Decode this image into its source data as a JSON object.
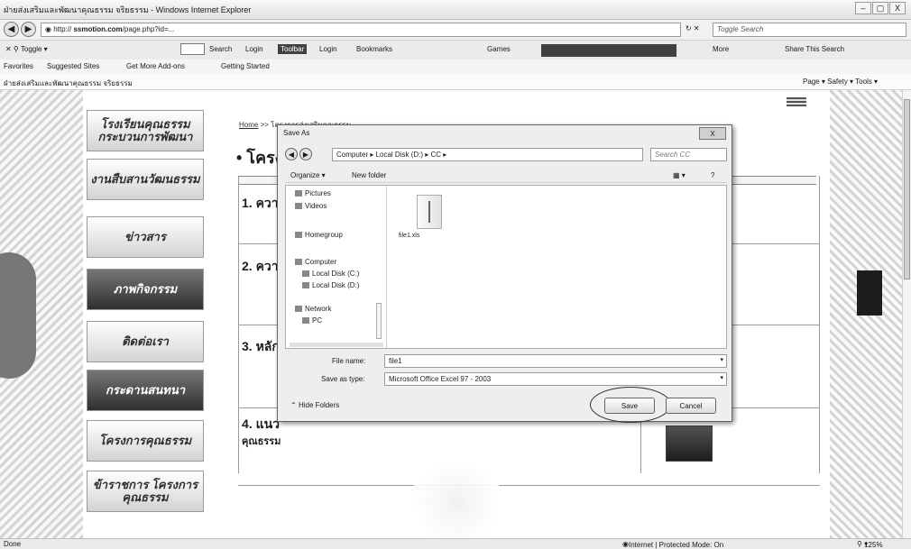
{
  "window": {
    "title": "ฝ่ายส่งเสริมและพัฒนาคุณธรรม จริยธรรม - Windows Internet Explorer",
    "buttons": {
      "minimize": "–",
      "maximize": "▢",
      "close": "X"
    }
  },
  "address_bar": {
    "url_domain": "ssmotion.com",
    "url_rest": "/page.php?id=...",
    "search_placeholder": "Toggle Search"
  },
  "toolbar": {
    "toggle": "Toggle",
    "search": "Search",
    "login": "Login",
    "toolbar_word": "Toolbar",
    "bookmarks": "Bookmarks",
    "games": "Games",
    "more": "More",
    "share": "Share This Search"
  },
  "favorites_bar": {
    "favorites": "Favorites",
    "suggested": "Suggested Sites",
    "addons": "Get More Add-ons",
    "getting_started": "Getting Started"
  },
  "tab": {
    "title": "ฝ่ายส่งเสริมและพัฒนาคุณธรรม จริยธรรม",
    "commands": "Page ▾  Safety ▾  Tools ▾"
  },
  "page": {
    "breadcrumb_home": "Home",
    "breadcrumb_rest": ">> โครงการส่งเสริมคุณธรรม",
    "title": "• โครงการ",
    "sidebar_banners": [
      "โรงเรียนคุณธรรม กระบวนการพัฒนา",
      "งานสืบสานวัฒนธรรม",
      "ข่าวสาร",
      "ภาพกิจกรรม",
      "ติดต่อเรา",
      "กระดานสนทนา",
      "โครงการคุณธรรม",
      "ข้าราชการ โครงการคุณธรรม"
    ],
    "items": [
      "1. ความ",
      "2. ความ",
      "3. หลัก",
      "4. แนว",
      "คุณธรรม"
    ]
  },
  "dialog": {
    "title": "Save As",
    "close": "X",
    "path": "Computer ▸ Local Disk (D:) ▸ CC ▸",
    "search": "Search CC",
    "organize": "Organize ▾",
    "new_folder": "New folder",
    "nav_items": [
      "Pictures",
      "Videos",
      "Homegroup",
      "Computer",
      "Local Disk (C:)",
      "Local Disk (D:)",
      "Network",
      "PC"
    ],
    "file_in_folder": "file1.xls",
    "filename_label": "File name:",
    "filename_value": "file1",
    "savetype_label": "Save as type:",
    "savetype_value": "Microsoft Office Excel 97 - 2003",
    "hide_folders": "Hide Folders",
    "save_button": "Save",
    "cancel_button": "Cancel"
  },
  "status": {
    "left": "Done",
    "zone": "Internet | Protected Mode: On",
    "zoom": "125%"
  }
}
